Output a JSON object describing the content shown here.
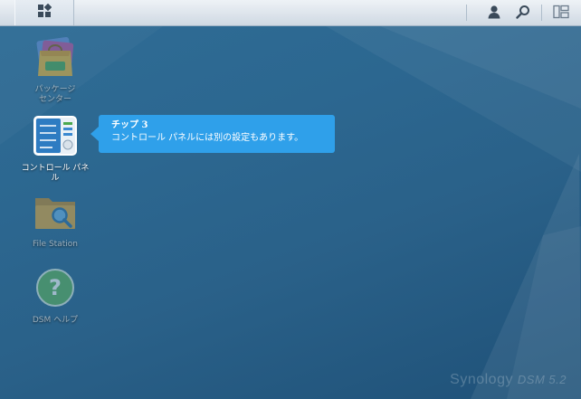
{
  "taskbar": {
    "main_menu_icon": "grid-icon",
    "user_icon": "user-icon",
    "search_icon": "search-icon",
    "widgets_icon": "widgets-icon"
  },
  "desktop": {
    "apps": [
      {
        "label": "パッケージ\nセンター",
        "icon": "package-center-icon"
      },
      {
        "label": "コントロール パネル",
        "icon": "control-panel-icon"
      },
      {
        "label": "File Station",
        "icon": "file-station-icon"
      },
      {
        "label": "DSM ヘルプ",
        "icon": "help-icon"
      }
    ]
  },
  "tooltip": {
    "title": "チップ 3",
    "body": "コントロール パネルには別の設定もあります。"
  },
  "branding": {
    "name": "Synology",
    "version": "DSM 5.2"
  },
  "colors": {
    "background": "#2c6790",
    "tooltip": "#2fa0ea",
    "taskbar": "#dfe6ed"
  }
}
